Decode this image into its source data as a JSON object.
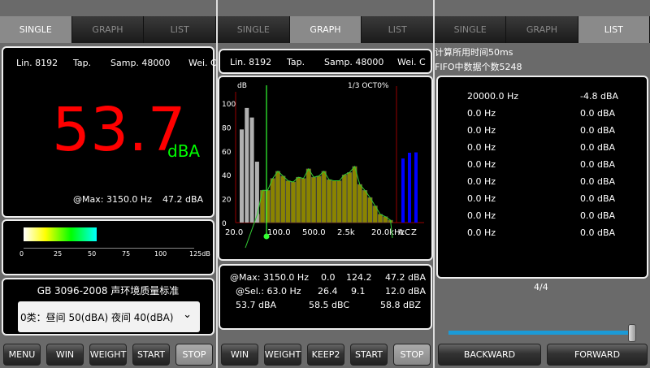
{
  "tabs": [
    "SINGLE",
    "GRAPH",
    "LIST"
  ],
  "single": {
    "info": {
      "lin": "Lin. 8192",
      "tap": "Tap.",
      "samp": "Samp. 48000",
      "wei": "Wei. C"
    },
    "level": "53.7",
    "unit": "dBA",
    "max_freq": "@Max: 3150.0 Hz",
    "max_level": "47.2 dBA",
    "meter": {
      "fill_db": 53.7,
      "ticks": [
        "0",
        "25",
        "50",
        "75",
        "100",
        "125dB"
      ]
    },
    "standard_title": "GB 3096-2008 声环境质量标准",
    "standard_select": "0类：昼间 50(dBA) 夜间 40(dBA)",
    "buttons": [
      "MENU",
      "WIN",
      "WEIGHT",
      "START",
      "STOP"
    ]
  },
  "graph": {
    "info": {
      "lin": "Lin. 8192",
      "tap": "Tap.",
      "samp": "Samp. 48000",
      "wei": "Wei. C"
    },
    "stats": {
      "r1": [
        "@Max: 3150.0 Hz",
        "0.0",
        "124.2",
        "47.2 dBA"
      ],
      "r2": [
        "@Sel.: 63.0 Hz",
        "26.4",
        "9.1",
        "12.0 dBA"
      ],
      "r3": [
        "53.7 dBA",
        "58.5 dBC",
        "58.8 dBZ"
      ]
    },
    "buttons": [
      "WIN",
      "WEIGHT",
      "KEEP2",
      "START",
      "STOP"
    ]
  },
  "chart_data": {
    "type": "bar",
    "ylabel": "dB",
    "mode_label": "1/3 OCT0%",
    "ylim": [
      0,
      100
    ],
    "yticks": [
      "0",
      "20",
      "40",
      "60",
      "80",
      "100"
    ],
    "xticks": [
      "20.0",
      "100.0",
      "500.0",
      "2.5k",
      "20.0kHz",
      "A",
      "C",
      "Z"
    ],
    "series": [
      {
        "color": "#b0b0b0",
        "values": [
          78,
          96,
          88,
          51
        ]
      },
      {
        "color": "#8a8400",
        "values": [
          7,
          27,
          27,
          37,
          43,
          39,
          35,
          34,
          38,
          37,
          45,
          38,
          39,
          43,
          36,
          35,
          35,
          40,
          42,
          47,
          32,
          27,
          21,
          14,
          7,
          5,
          2
        ]
      },
      {
        "color": "#0000ff",
        "values": [
          53.7,
          58.5,
          58.8
        ]
      }
    ],
    "cursor": "63.0 Hz"
  },
  "list": {
    "calc_time": "计算所用时间50ms",
    "fifo": "FIFO中数据个数5248",
    "rows": [
      [
        "20000.0 Hz",
        "-4.8 dBA"
      ],
      [
        "0.0 Hz",
        "0.0 dBA"
      ],
      [
        "0.0 Hz",
        "0.0 dBA"
      ],
      [
        "0.0 Hz",
        "0.0 dBA"
      ],
      [
        "0.0 Hz",
        "0.0 dBA"
      ],
      [
        "0.0 Hz",
        "0.0 dBA"
      ],
      [
        "0.0 Hz",
        "0.0 dBA"
      ],
      [
        "0.0 Hz",
        "0.0 dBA"
      ],
      [
        "0.0 Hz",
        "0.0 dBA"
      ]
    ],
    "page": "4/4",
    "slider_value": 1.0,
    "buttons": [
      "BACKWARD",
      "FORWARD"
    ]
  }
}
